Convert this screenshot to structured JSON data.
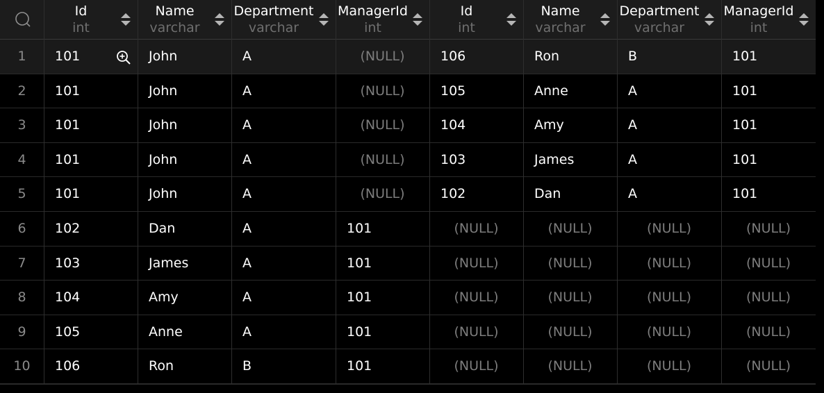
{
  "columns": [
    {
      "name": "Id",
      "type": "int"
    },
    {
      "name": "Name",
      "type": "varchar"
    },
    {
      "name": "Department",
      "type": "varchar"
    },
    {
      "name": "ManagerId",
      "type": "int"
    },
    {
      "name": "Id",
      "type": "int"
    },
    {
      "name": "Name",
      "type": "varchar"
    },
    {
      "name": "Department",
      "type": "varchar"
    },
    {
      "name": "ManagerId",
      "type": "int"
    }
  ],
  "rows": [
    {
      "n": "1",
      "c": [
        "101",
        "John",
        "A",
        "(NULL)",
        "106",
        "Ron",
        "B",
        "101"
      ]
    },
    {
      "n": "2",
      "c": [
        "101",
        "John",
        "A",
        "(NULL)",
        "105",
        "Anne",
        "A",
        "101"
      ]
    },
    {
      "n": "3",
      "c": [
        "101",
        "John",
        "A",
        "(NULL)",
        "104",
        "Amy",
        "A",
        "101"
      ]
    },
    {
      "n": "4",
      "c": [
        "101",
        "John",
        "A",
        "(NULL)",
        "103",
        "James",
        "A",
        "101"
      ]
    },
    {
      "n": "5",
      "c": [
        "101",
        "John",
        "A",
        "(NULL)",
        "102",
        "Dan",
        "A",
        "101"
      ]
    },
    {
      "n": "6",
      "c": [
        "102",
        "Dan",
        "A",
        "101",
        "(NULL)",
        "(NULL)",
        "(NULL)",
        "(NULL)"
      ]
    },
    {
      "n": "7",
      "c": [
        "103",
        "James",
        "A",
        "101",
        "(NULL)",
        "(NULL)",
        "(NULL)",
        "(NULL)"
      ]
    },
    {
      "n": "8",
      "c": [
        "104",
        "Amy",
        "A",
        "101",
        "(NULL)",
        "(NULL)",
        "(NULL)",
        "(NULL)"
      ]
    },
    {
      "n": "9",
      "c": [
        "105",
        "Anne",
        "A",
        "101",
        "(NULL)",
        "(NULL)",
        "(NULL)",
        "(NULL)"
      ]
    },
    {
      "n": "10",
      "c": [
        "106",
        "Ron",
        "B",
        "101",
        "(NULL)",
        "(NULL)",
        "(NULL)",
        "(NULL)"
      ]
    }
  ],
  "icons": {
    "search": "search-icon",
    "zoom": "zoom-in-icon",
    "sort": "sort-arrows-icon"
  },
  "colors": {
    "header_bg": "#1c1c1c",
    "selected_row": "#1a1a1a",
    "null_text": "#7d7d7d",
    "row_number": "#8a8a8a"
  }
}
